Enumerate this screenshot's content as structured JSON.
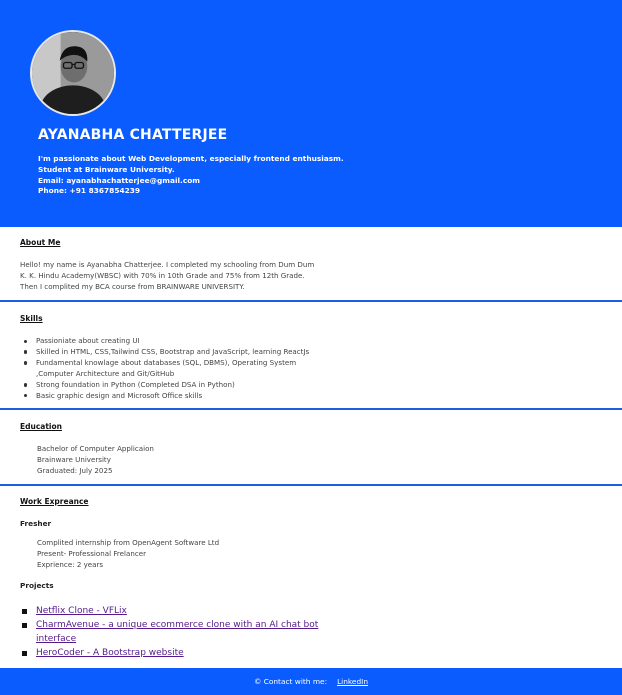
{
  "header": {
    "name": "AYANABHA CHATTERJEE",
    "intro_lines": [
      "I'm passionate about Web Development, especially frontend enthusiasm.",
      "Student at Brainware University.",
      "Email: ayanabhachatterjee@gmail.com",
      "Phone: +91 8367854239"
    ]
  },
  "about": {
    "title": "About Me",
    "lines": [
      "Hello! my name is Ayanabha Chatterjee. I completed my schooling from Dum Dum",
      "K. K. Hindu Academy(WBSC) with 70% in 10th Grade and 75% from 12th Grade.",
      "Then I complited my BCA course from BRAINWARE UNIVERSITY."
    ]
  },
  "skills": {
    "title": "Skills",
    "items": [
      "Passioniate about creating UI",
      "Skilled in HTML, CSS,Tailwind CSS, Bootstrap and JavaScript, learning ReactJs",
      "Fundamental knowlage about databases (SQL, DBMS), Operating System",
      ",Computer Architecture and Git/GitHub",
      "Strong foundation in Python (Completed DSA in Python)",
      "Basic graphic design and Microsoft Office skills"
    ]
  },
  "education": {
    "title": "Education",
    "lines": [
      "Bachelor of Computer Applicaion",
      "Brainware University",
      "Graduated: July 2025"
    ]
  },
  "work": {
    "title": "Work Expreance",
    "subtitle": "Fresher",
    "lines": [
      "Complited internship from OpenAgent Software Ltd",
      "Present- Professional Frelancer",
      "Exprience: 2 years"
    ],
    "projects_title": "Projects",
    "projects": [
      "Netflix Clone - VFLix",
      "CharmAvenue - a unique ecommerce clone with an AI chat bot interface",
      "HeroCoder - A Bootstrap website"
    ]
  },
  "footer": {
    "contact_label": "© Contact with me:",
    "link_label": "LinkedIn"
  },
  "colors": {
    "brand_blue": "#0a5cff",
    "separator": "#1d5fe0",
    "link": "#551a8b"
  }
}
